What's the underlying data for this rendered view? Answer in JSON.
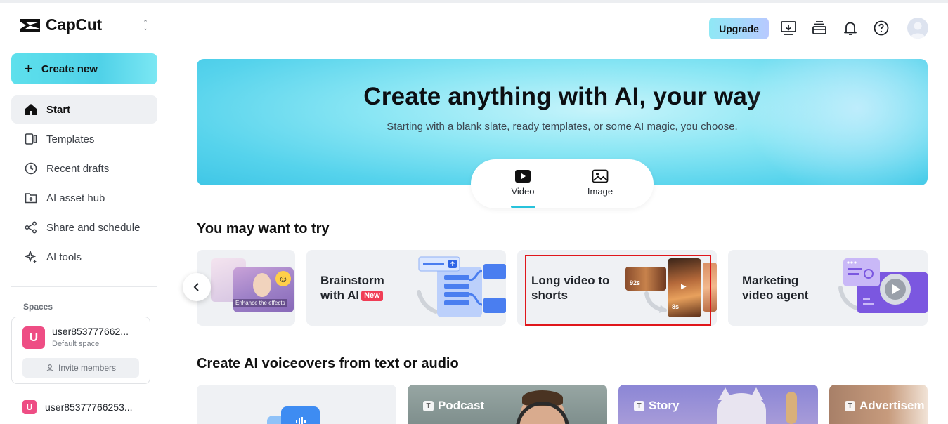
{
  "app": {
    "name": "CapCut"
  },
  "sidebar": {
    "create_label": "Create new",
    "items": [
      {
        "label": "Start",
        "icon": "home-icon",
        "active": true
      },
      {
        "label": "Templates",
        "icon": "templates-icon"
      },
      {
        "label": "Recent drafts",
        "icon": "clock-icon"
      },
      {
        "label": "AI asset hub",
        "icon": "asset-hub-icon"
      },
      {
        "label": "Share and schedule",
        "icon": "share-icon"
      },
      {
        "label": "AI tools",
        "icon": "sparkle-icon"
      }
    ],
    "spaces_label": "Spaces",
    "space": {
      "initial": "U",
      "name": "user853777662...",
      "subtitle": "Default space",
      "invite_label": "Invite members"
    },
    "user": {
      "initial": "U",
      "name": "user85377766253..."
    }
  },
  "header": {
    "upgrade_label": "Upgrade",
    "icons": [
      "download-screen-icon",
      "stack-icon",
      "bell-icon",
      "help-icon",
      "user-avatar"
    ]
  },
  "hero": {
    "title": "Create anything with AI, your way",
    "subtitle": "Starting with a blank slate, ready templates, or some AI magic, you choose.",
    "tabs": [
      {
        "label": "Video",
        "active": true
      },
      {
        "label": "Image"
      }
    ]
  },
  "try_section": {
    "title": "You may want to try",
    "cards": [
      {
        "label": "",
        "thumb_text": "Enhance the effects"
      },
      {
        "label": "Brainstorm with AI",
        "line1": "Brainstorm",
        "line2": "with AI",
        "badge": "New"
      },
      {
        "label": "Long video to shorts",
        "line1": "Long video to",
        "line2": "shorts",
        "badge_left": "92s",
        "badge_right": "8s",
        "highlighted": true
      },
      {
        "label": "Marketing video agent",
        "line1": "Marketing",
        "line2": "video agent"
      }
    ]
  },
  "voiceover_section": {
    "title": "Create AI voiceovers from text or audio",
    "cards": [
      {
        "label": ""
      },
      {
        "label": "Podcast"
      },
      {
        "label": "Story"
      },
      {
        "label": "Advertisem"
      }
    ]
  },
  "colors": {
    "accent": "#4fd1e8",
    "highlight": "#e0161b",
    "new_badge": "#f03d55",
    "avatar": "#ee4d84"
  }
}
